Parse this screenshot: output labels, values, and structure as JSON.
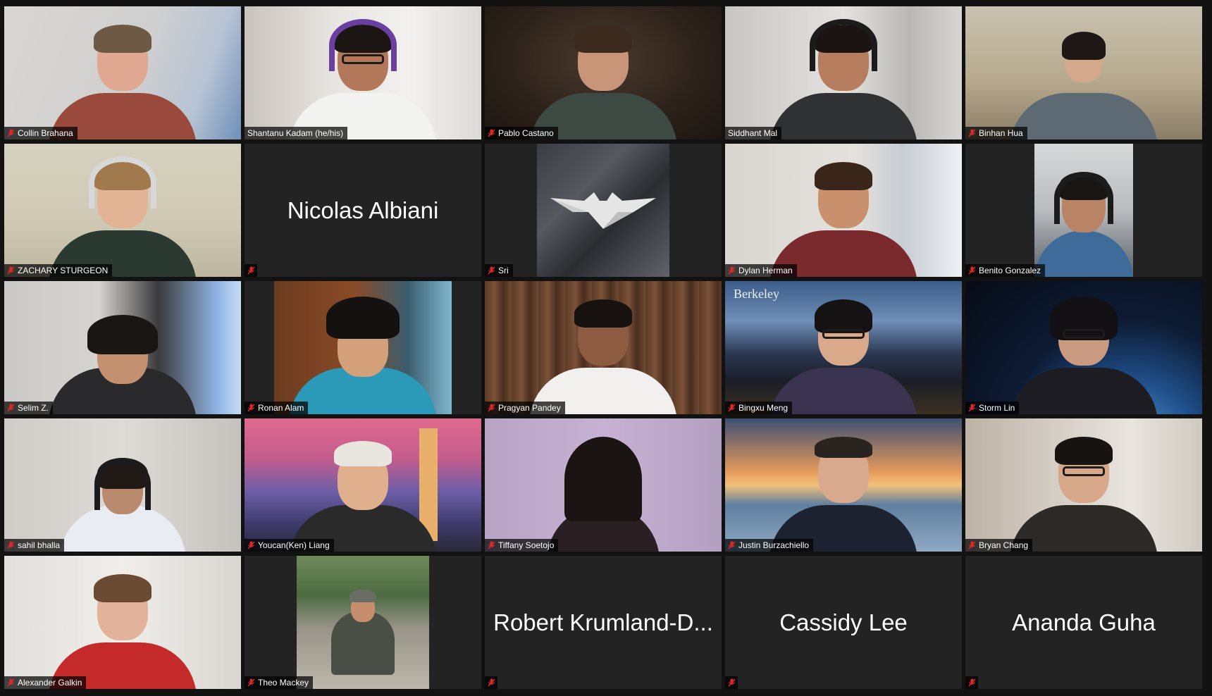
{
  "app": {
    "view": "Gallery View",
    "mute_color": "#e02828",
    "active_speaker_color": "#d7e26b"
  },
  "participants": [
    {
      "name": "Collin Brahana",
      "muted": true,
      "video": true
    },
    {
      "name": "Shantanu Kadam (he/his)",
      "muted": false,
      "video": true
    },
    {
      "name": "Pablo Castano",
      "muted": true,
      "video": true
    },
    {
      "name": "Siddhant Mal",
      "muted": false,
      "video": true,
      "active_speaker": true
    },
    {
      "name": "Binhan Hua",
      "muted": true,
      "video": true
    },
    {
      "name": "ZACHARY STURGEON",
      "muted": true,
      "video": true
    },
    {
      "name": "Nicolas Albiani",
      "muted": true,
      "video": false
    },
    {
      "name": "Sri",
      "muted": true,
      "video": true
    },
    {
      "name": "Dylan Herman",
      "muted": true,
      "video": true
    },
    {
      "name": "Benito Gonzalez",
      "muted": true,
      "video": true
    },
    {
      "name": "Selim Z.",
      "muted": true,
      "video": true
    },
    {
      "name": "Ronan Alam",
      "muted": true,
      "video": true
    },
    {
      "name": "Pragyan Pandey",
      "muted": true,
      "video": true
    },
    {
      "name": "Bingxu Meng",
      "muted": true,
      "video": true
    },
    {
      "name": "Storm Lin",
      "muted": true,
      "video": true
    },
    {
      "name": "sahil bhalla",
      "muted": true,
      "video": true
    },
    {
      "name": "Youcan(Ken) Liang",
      "muted": true,
      "video": true
    },
    {
      "name": "Tiffany Soetojo",
      "muted": true,
      "video": true
    },
    {
      "name": "Justin Burzachiello",
      "muted": true,
      "video": true
    },
    {
      "name": "Bryan Chang",
      "muted": true,
      "video": true
    },
    {
      "name": "Alexander Galkin",
      "muted": true,
      "video": true
    },
    {
      "name": "Theo Mackey",
      "muted": true,
      "video": true
    },
    {
      "name": "Robert Krumland-D...",
      "muted": true,
      "video": false
    },
    {
      "name": "Cassidy Lee",
      "muted": true,
      "video": false
    },
    {
      "name": "Ananda Guha",
      "muted": true,
      "video": false
    }
  ],
  "overlay_text": {
    "bingxu_background": "Berkeley"
  }
}
